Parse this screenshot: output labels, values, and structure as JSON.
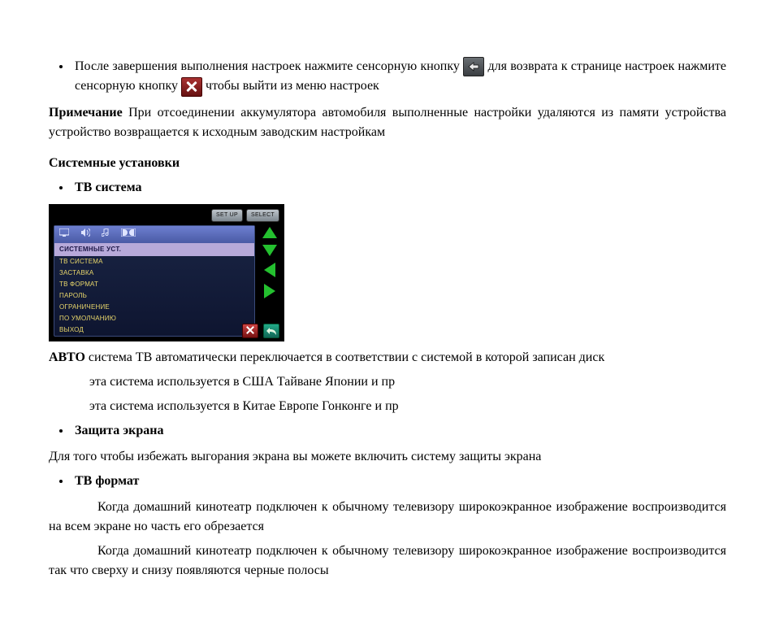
{
  "bullet1": {
    "part1": "После завершения выполнения настроек нажмите сенсорную кнопку ",
    "part2": " для возврата к странице настроек ",
    "part3": " нажмите сенсорную кнопку ",
    "part4": " чтобы выйти из меню настроек"
  },
  "note": {
    "label": "Примечание",
    "text": "  При отсоединении аккумулятора автомобиля выполненные настройки удаляются из памяти устройства  устройство возвращается к исходным заводским настройкам"
  },
  "heading_system": "Системные установки",
  "bullet_tv": "ТВ система",
  "device": {
    "btn_setup": "SET UP",
    "btn_select": "SELECT",
    "title": "СИСТЕМНЫЕ УСТ.",
    "items": [
      "ТВ СИСТЕМА",
      "ЗАСТАВКА",
      "ТВ ФОРМАТ",
      "ПАРОЛЬ",
      "ОГРАНИЧЕНИЕ",
      "ПО УМОЛЧАНИЮ",
      "ВЫХОД"
    ]
  },
  "auto": {
    "label": "АВТО",
    "text": "  система ТВ автоматически переключается в соответствии с системой  в которой записан диск"
  },
  "line_ntsc": "эта система используется в США  Тайване  Японии и пр",
  "line_pal": "эта система используется в Китае  Европе  Гонконге и пр",
  "bullet_screen": "Защита экрана",
  "screen_text": "Для того чтобы избежать  выгорания экрана    вы можете включить систему защиты экрана",
  "bullet_tvformat": "ТВ формат",
  "tvf1": "Когда домашний кинотеатр подключен к обычному телевизору  широкоэкранное изображение воспроизводится на всем экране  но часть его обрезается",
  "tvf2": "Когда домашний кинотеатр подключен к обычному телевизору  широкоэкранное изображение воспроизводится так  что сверху и снизу появляются черные полосы"
}
